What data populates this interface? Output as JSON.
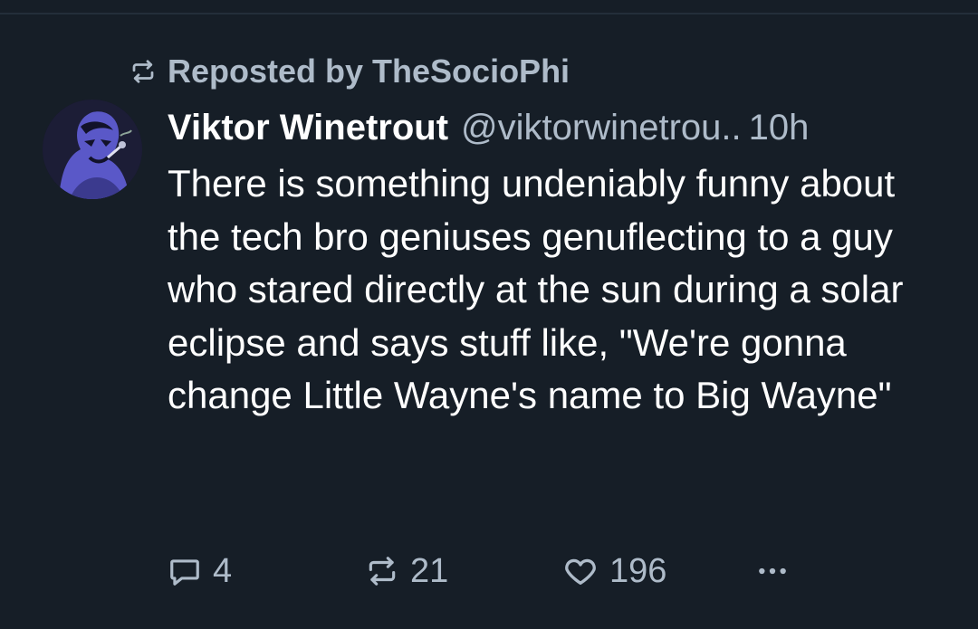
{
  "repost_banner": {
    "icon": "repost-icon",
    "text": "Reposted by TheSocioPhi"
  },
  "post": {
    "avatar": "avatar",
    "display_name": "Viktor Winetrout",
    "handle": "@viktorwinetrou..",
    "time": "10h",
    "text": "There is something undeniably funny about the tech bro geniuses genuflecting to a guy who stared directly at the sun during a solar eclipse and says stuff like, \"We're gonna change Little Wayne's name to Big Wayne\""
  },
  "actions": {
    "reply": {
      "icon": "reply-icon",
      "count": "4"
    },
    "repost": {
      "icon": "repost-icon",
      "count": "21"
    },
    "like": {
      "icon": "heart-icon",
      "count": "196"
    },
    "more": {
      "icon": "more-icon"
    }
  },
  "colors": {
    "background": "#161e27",
    "muted_text": "#aebbc9",
    "primary_text": "#ffffff"
  }
}
